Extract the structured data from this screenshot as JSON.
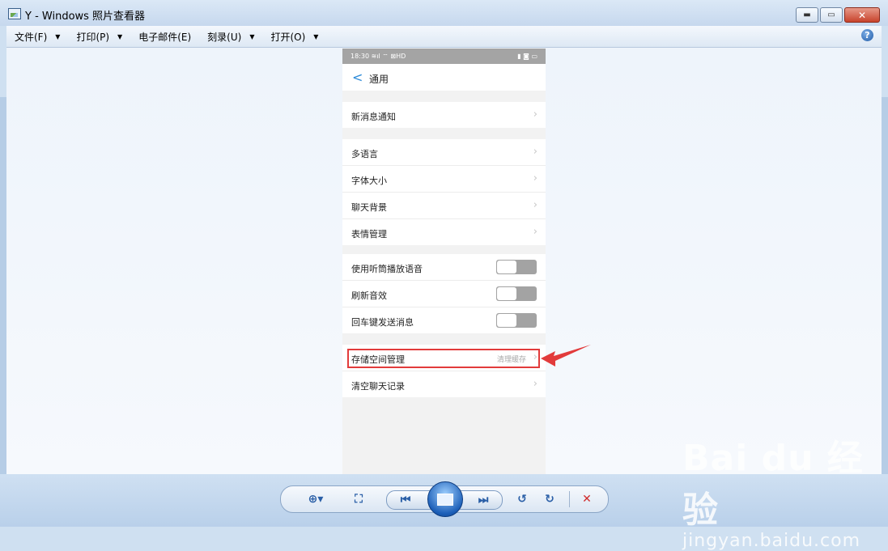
{
  "window": {
    "title": "Y - Windows 照片查看器",
    "controls": {
      "minimize": "▬",
      "maximize": "▭",
      "close": "✕"
    }
  },
  "menubar": {
    "items": [
      {
        "label": "文件(F)",
        "has_dropdown": true
      },
      {
        "label": "打印(P)",
        "has_dropdown": true
      },
      {
        "label": "电子邮件(E)",
        "has_dropdown": false
      },
      {
        "label": "刻录(U)",
        "has_dropdown": true
      },
      {
        "label": "打开(O)",
        "has_dropdown": true
      }
    ],
    "help": "?"
  },
  "phone": {
    "status_time": "18:30",
    "status_left_icons": "≋ıl ⌔ ⊠HD",
    "status_right_icons": "▮ ◙ ▭",
    "header_title": "通用",
    "groups": [
      {
        "rows": [
          {
            "label": "新消息通知",
            "type": "chevron"
          }
        ]
      },
      {
        "rows": [
          {
            "label": "多语言",
            "type": "chevron"
          },
          {
            "label": "字体大小",
            "type": "chevron"
          },
          {
            "label": "聊天背景",
            "type": "chevron"
          },
          {
            "label": "表情管理",
            "type": "chevron"
          }
        ]
      },
      {
        "rows": [
          {
            "label": "使用听筒播放语音",
            "type": "toggle",
            "on": false
          },
          {
            "label": "刷新音效",
            "type": "toggle",
            "on": false
          },
          {
            "label": "回车键发送消息",
            "type": "toggle",
            "on": false
          }
        ]
      },
      {
        "rows": [
          {
            "label": "存储空间管理",
            "type": "chevron",
            "value": "清理缓存"
          },
          {
            "label": "清空聊天记录",
            "type": "chevron"
          }
        ]
      }
    ],
    "chevron_glyph": "›",
    "back_glyph": "<"
  },
  "annotation": {
    "highlight_color": "#e23b3b"
  },
  "toolbar": {
    "zoom_icon": "⊕▾",
    "actual_size_icon": "⛶",
    "prev_icon": "⏮",
    "next_icon": "⏭",
    "rotate_left_icon": "↺",
    "rotate_right_icon": "↻",
    "delete_icon": "✕"
  },
  "watermark": {
    "logo": "Bai du 经验",
    "url": "jingyan.baidu.com"
  }
}
